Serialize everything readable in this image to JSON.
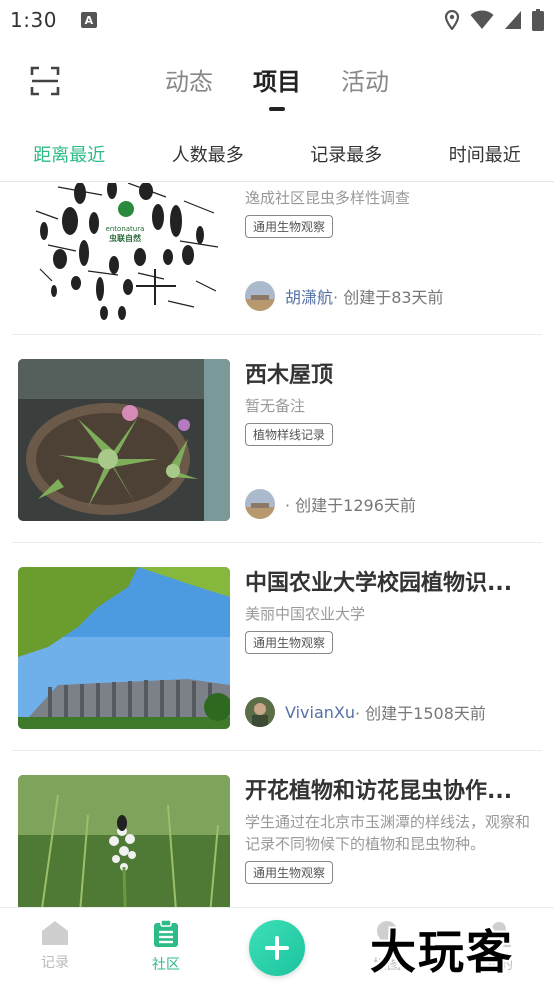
{
  "status_bar": {
    "time": "1:30",
    "notification_letter": "A"
  },
  "header": {
    "tabs": [
      {
        "label": "动态",
        "active": false
      },
      {
        "label": "项目",
        "active": true
      },
      {
        "label": "活动",
        "active": false
      }
    ]
  },
  "sort": {
    "options": [
      "距离最近",
      "人数最多",
      "记录最多",
      "时间最近"
    ],
    "active_index": 0,
    "accent_color": "#2dbb86"
  },
  "projects": [
    {
      "title": "",
      "note": "逸成社区昆虫多样性调查",
      "tag": "通用生物观察",
      "author": "胡潇航",
      "created": "· 创建于83天前",
      "thumb_logo_en": "entonatura",
      "thumb_logo_cn": "虫联自然"
    },
    {
      "title": "西木屋顶",
      "note": "暂无备注",
      "tag": "植物样线记录",
      "author": "",
      "created": "· 创建于1296天前"
    },
    {
      "title": "中国农业大学校园植物识...",
      "note": "美丽中国农业大学",
      "tag": "通用生物观察",
      "author": "VivianXu",
      "created": "· 创建于1508天前"
    },
    {
      "title": "开花植物和访花昆虫协作...",
      "note": "学生通过在北京市玉渊潭的样线法，观察和记录不同物候下的植物和昆虫物种。",
      "tag": "通用生物观察",
      "author": "",
      "created": ""
    }
  ],
  "bottom_nav": {
    "items": [
      {
        "label": "记录",
        "icon": "home-icon",
        "active": false
      },
      {
        "label": "社区",
        "icon": "clipboard-icon",
        "active": true
      },
      {
        "label": "地图",
        "icon": "map-pin-icon",
        "active": false
      },
      {
        "label": "我的",
        "icon": "profile-icon",
        "active": false
      }
    ],
    "fab_icon": "plus-icon"
  },
  "watermark": "大玩客"
}
